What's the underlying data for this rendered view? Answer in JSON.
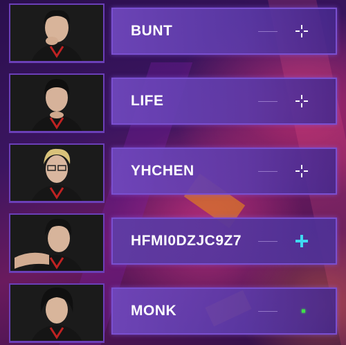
{
  "players": [
    {
      "name": "BUNT",
      "status_icon": "crosshair-icon",
      "status_color": "#ffffff"
    },
    {
      "name": "LIFE",
      "status_icon": "crosshair-icon",
      "status_color": "#ffffff"
    },
    {
      "name": "YHCHEN",
      "status_icon": "crosshair-icon",
      "status_color": "#ffffff"
    },
    {
      "name": "HFMI0DZJC9Z7",
      "status_icon": "plus-icon",
      "status_color": "#3fd9f0"
    },
    {
      "name": "MONK",
      "status_icon": "ready-dot-icon",
      "status_color": "#3fe04a"
    }
  ],
  "theme": {
    "panel_border": "#7a4fd0",
    "portrait_border": "#6b3fb8"
  }
}
